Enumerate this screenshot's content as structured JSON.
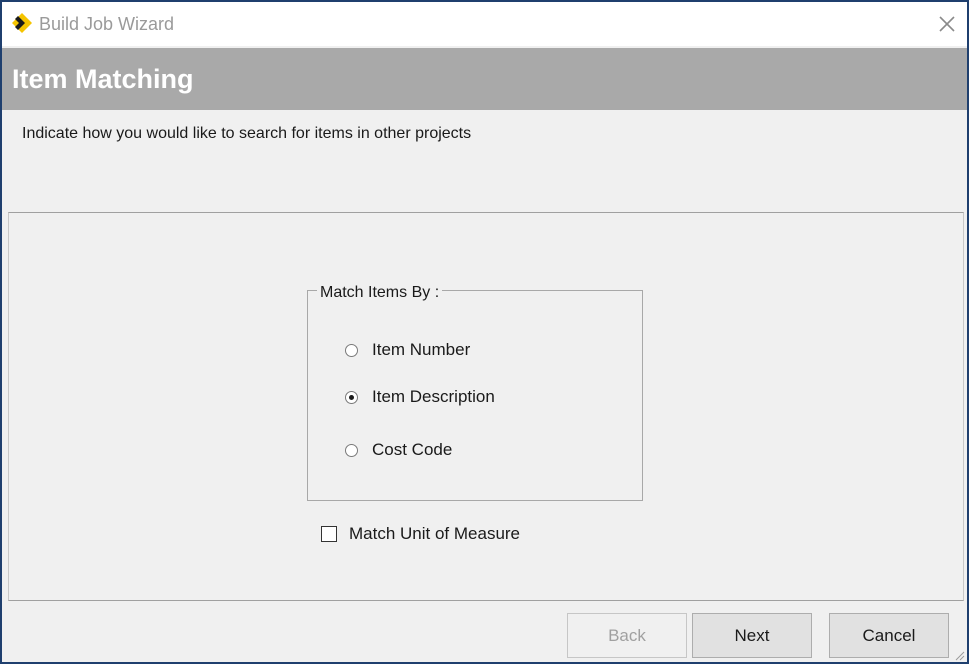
{
  "window": {
    "title": "Build Job Wizard"
  },
  "header": {
    "title": "Item Matching"
  },
  "instructions": "Indicate how you would like to search for items in other projects",
  "match_group": {
    "legend": "Match Items By :",
    "options": [
      {
        "label": "Item Number",
        "selected": false
      },
      {
        "label": "Item Description",
        "selected": true
      },
      {
        "label": "Cost Code",
        "selected": false
      }
    ]
  },
  "match_unit_checkbox": {
    "label": "Match Unit of Measure",
    "checked": false
  },
  "footer": {
    "back_label": "Back",
    "back_enabled": false,
    "next_label": "Next",
    "cancel_label": "Cancel"
  },
  "icons": {
    "app": "wizard-logo-icon",
    "close": "close-icon"
  },
  "colors": {
    "header_band": "#a9a9a9",
    "window_border": "#1f3f6e",
    "logo_yellow": "#f5c400"
  }
}
